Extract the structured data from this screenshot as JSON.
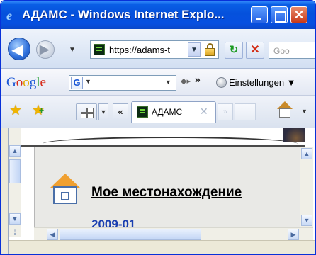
{
  "window": {
    "title": "АДАМС - Windows Internet Explo...",
    "icon": "ie-icon",
    "controls": {
      "minimize": "minimize",
      "maximize": "maximize",
      "close": "✕"
    }
  },
  "address_bar": {
    "url": "https://adams-t",
    "search_placeholder": "Goo",
    "lock_icon": "lock-icon",
    "refresh_icon": "refresh-icon",
    "stop_label": "✕"
  },
  "google_toolbar": {
    "logo": "Google",
    "search_icon_label": "G",
    "more": "»",
    "settings_label": "Einstellungen"
  },
  "tabs": {
    "scroll_left_label": "«",
    "active_tab_title": "АДАМС",
    "close_label": "✕",
    "scroll_right_label": "»"
  },
  "content": {
    "location_link": "Мое местонахождение",
    "date_text": "2009-01"
  },
  "colors": {
    "titlebar": "#0551dc",
    "link_date": "#1a3fb0",
    "house_roof": "#f0a030"
  }
}
